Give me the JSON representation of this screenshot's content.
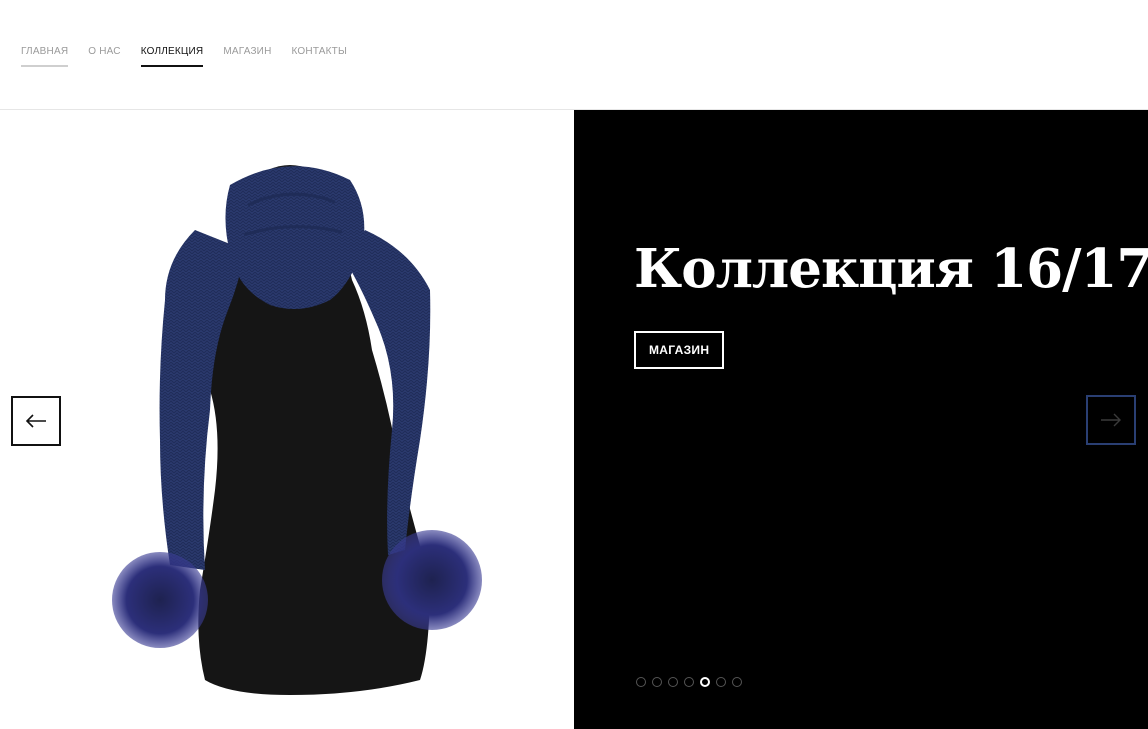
{
  "nav": {
    "items": [
      {
        "label": "ГЛАВНАЯ"
      },
      {
        "label": "О НАС"
      },
      {
        "label": "КОЛЛЕКЦИЯ"
      },
      {
        "label": "МАГАЗИН"
      },
      {
        "label": "КОНТАКТЫ"
      }
    ],
    "active_index": 2
  },
  "slide": {
    "title": "Коллекция 16/17",
    "button_label": "МАГАЗИН",
    "image_subject": "navy knitted scarf with fur pompoms on black mannequin"
  },
  "slider": {
    "prev_icon": "arrow-left-icon",
    "next_icon": "arrow-right-icon",
    "dot_count": 7,
    "active_dot": 4
  },
  "colors": {
    "panel_bg": "#000000",
    "scarf": "#2b3a6e",
    "mannequin": "#151515",
    "next_arrow_border": "#2a3f73"
  }
}
